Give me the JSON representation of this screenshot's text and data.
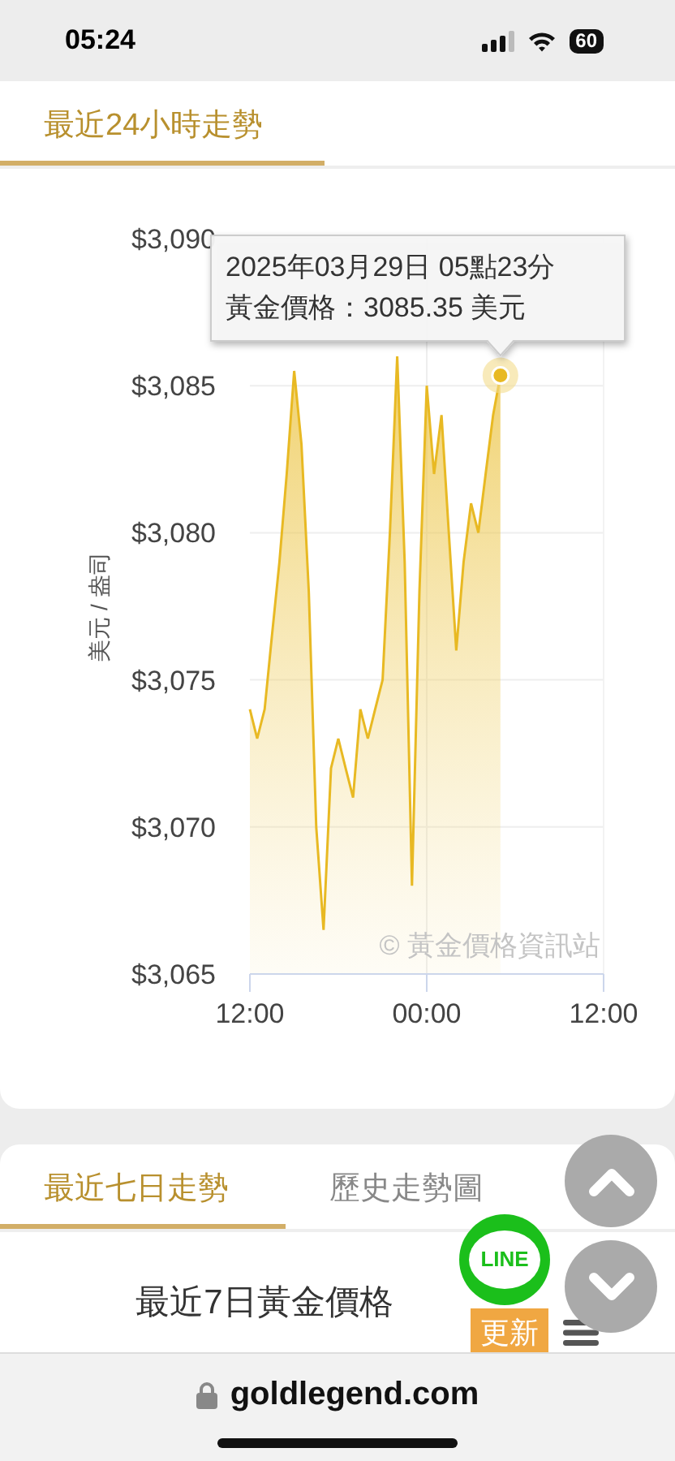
{
  "status_bar": {
    "time": "05:24",
    "battery": "60"
  },
  "top_card": {
    "tabs": [
      {
        "label": "最近24小時走勢",
        "selected": true
      }
    ],
    "chart_data": {
      "type": "area",
      "ylabel": "美元 / 盎司",
      "categories": [
        "12:00",
        null,
        null,
        null,
        null,
        null,
        null,
        null,
        null,
        null,
        null,
        null,
        null,
        null,
        null,
        null,
        null,
        null,
        null,
        null,
        null,
        null,
        null,
        null,
        "00:00",
        null,
        null,
        null,
        null,
        null,
        null,
        null,
        null,
        null,
        null,
        null,
        null,
        null,
        null,
        null,
        null,
        null,
        null,
        null,
        null,
        null,
        null,
        null,
        "12:00"
      ],
      "series": [
        {
          "color": "#e8b923",
          "values": [
            3074,
            3073,
            3074,
            3076.5,
            3079,
            3082,
            3085.5,
            3083,
            3078,
            3070,
            3066.5,
            3072,
            3073,
            3072,
            3071,
            3074,
            3073,
            3074,
            3075,
            3080,
            3086,
            3079,
            3068,
            3078,
            3085,
            3082,
            3084,
            3080,
            3076,
            3079,
            3081,
            3080,
            3082,
            3084,
            3085.35,
            null,
            null,
            null,
            null,
            null,
            null,
            null,
            null,
            null,
            null,
            null,
            null,
            null,
            null
          ]
        }
      ],
      "ylim": [
        3065,
        3090
      ],
      "grid": true,
      "yticks": [
        {
          "value": 3065,
          "label": "$3,065"
        },
        {
          "value": 3070,
          "label": "$3,070"
        },
        {
          "value": 3075,
          "label": "$3,075"
        },
        {
          "value": 3080,
          "label": "$3,080"
        },
        {
          "value": 3085,
          "label": "$3,085"
        },
        {
          "value": 3090,
          "label": "$3,090"
        }
      ]
    },
    "tooltip": {
      "lines": [
        "2025年03月29日 05點23分",
        "黃金價格：3085.35 美元"
      ]
    },
    "credit": "© 黃金價格資訊站"
  },
  "bottom_card": {
    "tabs": [
      {
        "label": "最近七日走勢",
        "selected": true
      },
      {
        "label": "歷史走勢圖",
        "selected": false
      }
    ],
    "title": "最近7日黃金價格",
    "update_button": "更新",
    "line_badge": "LINE"
  },
  "browser_bar": {
    "url": "goldlegend.com"
  }
}
